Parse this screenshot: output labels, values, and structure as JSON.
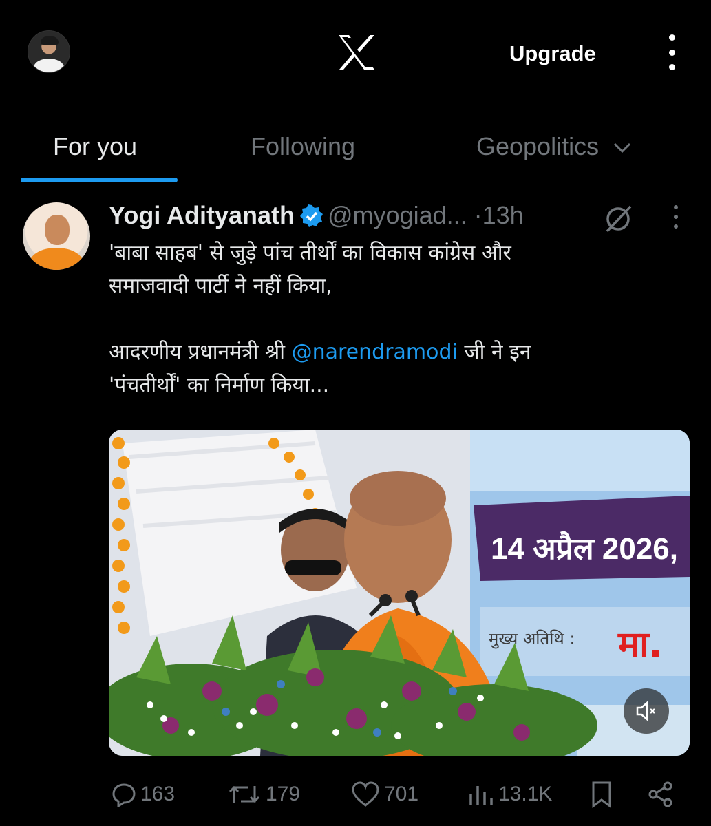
{
  "header": {
    "logo": "x-logo",
    "upgrade_label": "Upgrade",
    "more_icon": "more-vertical-icon"
  },
  "tabs": [
    {
      "label": "For you",
      "active": true
    },
    {
      "label": "Following",
      "active": false
    },
    {
      "label": "Geopolitics",
      "active": false,
      "icon": "chevron-down-icon"
    }
  ],
  "tweet": {
    "author_name": "Yogi Adityanath",
    "verified": true,
    "handle": "@myogiad...",
    "separator": "·",
    "time": "13h",
    "text_line1": "'बाबा साहब' से जुड़े पांच तीर्थों का विकास कांग्रेस और",
    "text_line2": "समाजवादी पार्टी ने नहीं किया,",
    "text_line3_pre": "आदरणीय प्रधानमंत्री श्री ",
    "mention": "@narendramodi",
    "text_line3_post": " जी ने इन",
    "text_line4": "'पंचतीर्थों' का निर्माण किया...",
    "media": {
      "banner_text": "14 अप्रैल 2026, ",
      "guest_label": "मुख्य अतिथि :",
      "guest_name": "मा."
    },
    "stats": {
      "replies": "163",
      "reposts": "179",
      "likes": "701",
      "views": "13.1K"
    }
  },
  "colors": {
    "accent": "#1d9bf0",
    "muted": "#71767b",
    "text": "#e7e9ea",
    "background": "#000000"
  }
}
